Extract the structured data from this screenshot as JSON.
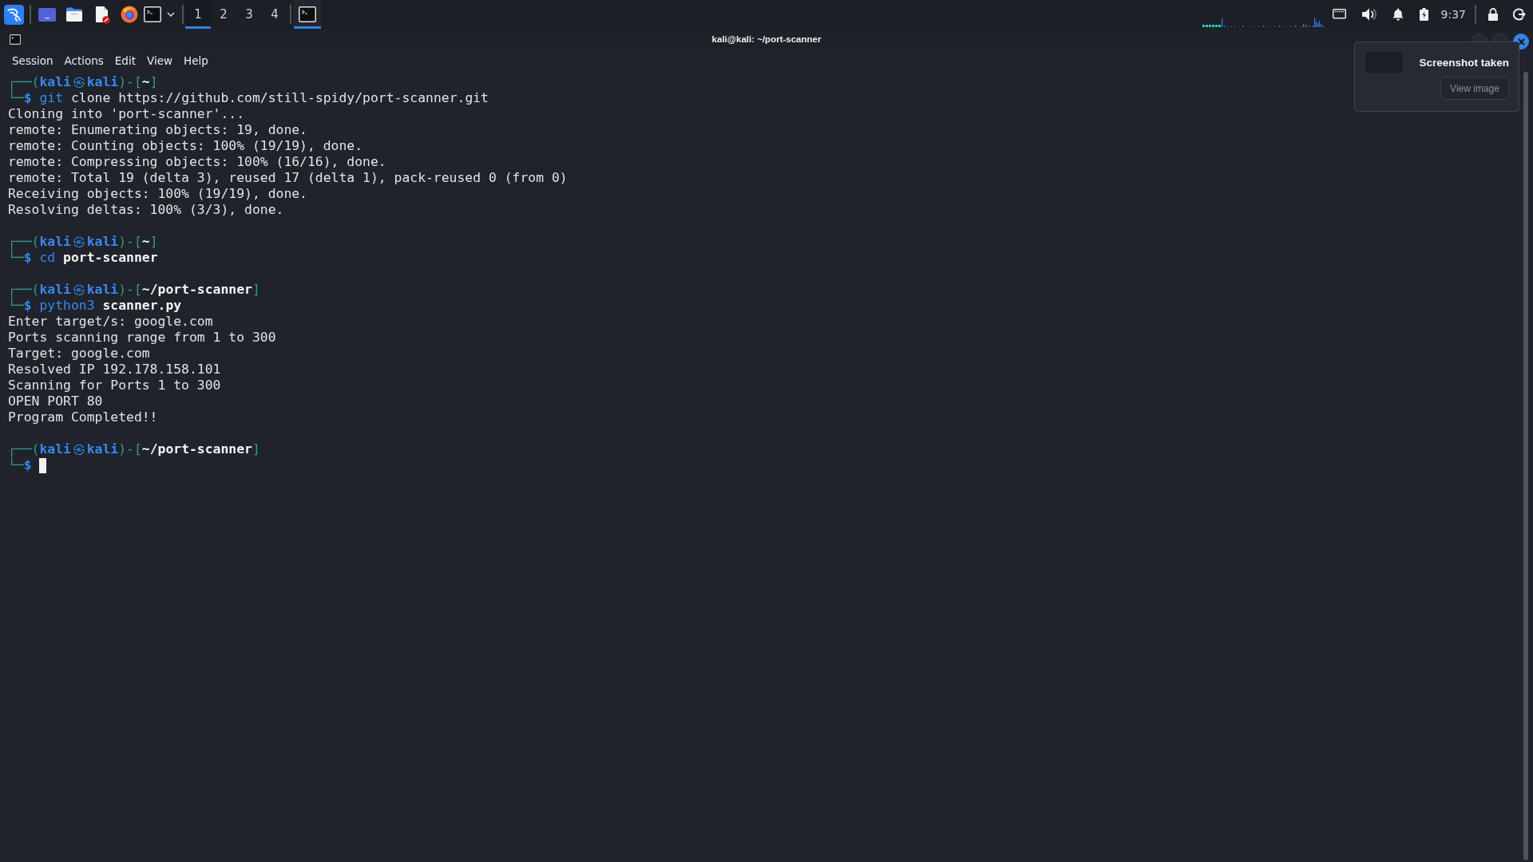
{
  "taskbar": {
    "workspaces": [
      {
        "label": "1",
        "selected": true
      },
      {
        "label": "2",
        "selected": false
      },
      {
        "label": "3",
        "selected": false
      },
      {
        "label": "4",
        "selected": false
      }
    ],
    "tasks": [
      {
        "selected": true
      }
    ],
    "clock": "9:37"
  },
  "window": {
    "title": "kali@kali: ~/port-scanner",
    "menu": [
      "Session",
      "Actions",
      "Edit",
      "View",
      "Help"
    ]
  },
  "terminal": {
    "lines": [
      {
        "kind": "prompt",
        "segments": [
          {
            "text": "┌──(",
            "kind": "frame"
          },
          {
            "text": "kali",
            "kind": "user"
          },
          {
            "text": "㉿",
            "kind": "mark"
          },
          {
            "text": "kali",
            "kind": "user"
          },
          {
            "text": ")-[",
            "kind": "frame"
          },
          {
            "text": "~",
            "kind": "path"
          },
          {
            "text": "]",
            "kind": "frame"
          }
        ]
      },
      {
        "kind": "command",
        "cursor": false,
        "segments": [
          {
            "text": "└─",
            "kind": "frame"
          },
          {
            "text": "$",
            "kind": "user"
          },
          {
            "text": " git",
            "kind": "command"
          },
          {
            "text": " clone https://github.com/still-spidy/port-scanner.git",
            "kind": "argument"
          }
        ]
      },
      {
        "kind": "output",
        "text": "Cloning into 'port-scanner'..."
      },
      {
        "kind": "output",
        "text": "remote: Enumerating objects: 19, done."
      },
      {
        "kind": "output",
        "text": "remote: Counting objects: 100% (19/19), done."
      },
      {
        "kind": "output",
        "text": "remote: Compressing objects: 100% (16/16), done."
      },
      {
        "kind": "output",
        "text": "remote: Total 19 (delta 3), reused 17 (delta 1), pack-reused 0 (from 0)"
      },
      {
        "kind": "output",
        "text": "Receiving objects: 100% (19/19), done."
      },
      {
        "kind": "output",
        "text": "Resolving deltas: 100% (3/3), done."
      },
      {
        "kind": "blank"
      },
      {
        "kind": "prompt",
        "segments": [
          {
            "text": "┌──(",
            "kind": "frame"
          },
          {
            "text": "kali",
            "kind": "user"
          },
          {
            "text": "㉿",
            "kind": "mark"
          },
          {
            "text": "kali",
            "kind": "user"
          },
          {
            "text": ")-[",
            "kind": "frame"
          },
          {
            "text": "~",
            "kind": "path"
          },
          {
            "text": "]",
            "kind": "frame"
          }
        ]
      },
      {
        "kind": "command",
        "cursor": false,
        "segments": [
          {
            "text": "└─",
            "kind": "frame"
          },
          {
            "text": "$",
            "kind": "user"
          },
          {
            "text": " cd",
            "kind": "command"
          },
          {
            "text": " port-scanner",
            "kind": "path"
          }
        ]
      },
      {
        "kind": "blank"
      },
      {
        "kind": "prompt",
        "segments": [
          {
            "text": "┌──(",
            "kind": "frame"
          },
          {
            "text": "kali",
            "kind": "user"
          },
          {
            "text": "㉿",
            "kind": "mark"
          },
          {
            "text": "kali",
            "kind": "user"
          },
          {
            "text": ")-[",
            "kind": "frame"
          },
          {
            "text": "~/port-scanner",
            "kind": "path"
          },
          {
            "text": "]",
            "kind": "frame"
          }
        ]
      },
      {
        "kind": "command",
        "cursor": false,
        "segments": [
          {
            "text": "└─",
            "kind": "frame"
          },
          {
            "text": "$",
            "kind": "user"
          },
          {
            "text": " python3",
            "kind": "command"
          },
          {
            "text": " scanner.py",
            "kind": "path"
          }
        ]
      },
      {
        "kind": "output",
        "text": "Enter target/s: google.com"
      },
      {
        "kind": "output",
        "text": "Ports scanning range from 1 to 300"
      },
      {
        "kind": "output",
        "text": "Target: google.com"
      },
      {
        "kind": "output",
        "text": "Resolved IP 192.178.158.101"
      },
      {
        "kind": "output",
        "text": "Scanning for Ports 1 to 300"
      },
      {
        "kind": "output",
        "text": "OPEN PORT 80"
      },
      {
        "kind": "output",
        "text": "Program Completed!!"
      },
      {
        "kind": "blank"
      },
      {
        "kind": "prompt",
        "segments": [
          {
            "text": "┌──(",
            "kind": "frame"
          },
          {
            "text": "kali",
            "kind": "user"
          },
          {
            "text": "㉿",
            "kind": "mark"
          },
          {
            "text": "kali",
            "kind": "user"
          },
          {
            "text": ")-[",
            "kind": "frame"
          },
          {
            "text": "~/port-scanner",
            "kind": "path"
          },
          {
            "text": "]",
            "kind": "frame"
          }
        ]
      },
      {
        "kind": "command",
        "cursor": true,
        "segments": [
          {
            "text": "└─",
            "kind": "frame"
          },
          {
            "text": "$",
            "kind": "user"
          }
        ]
      }
    ]
  },
  "notification": {
    "title": "Screenshot taken",
    "button": "View image"
  }
}
